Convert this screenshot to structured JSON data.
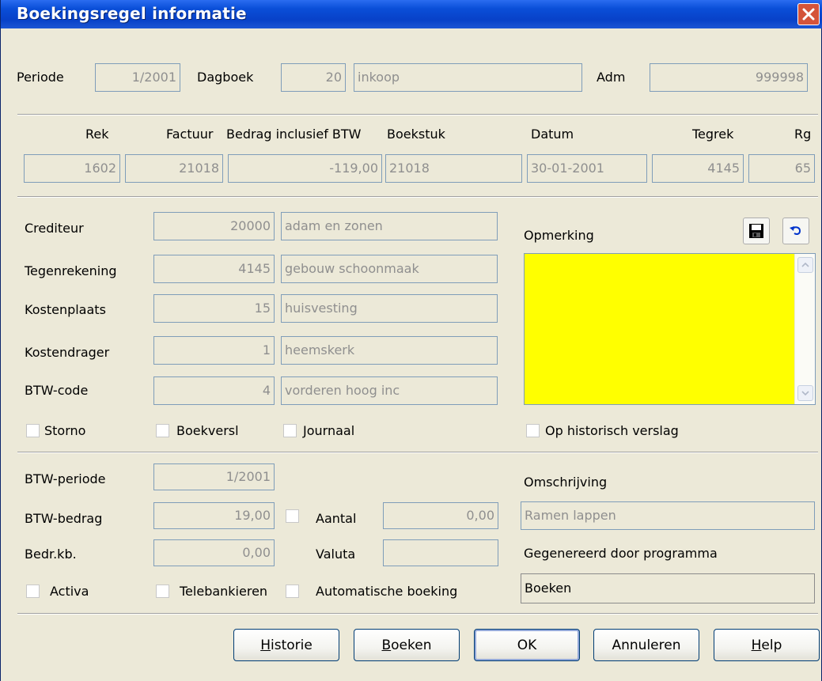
{
  "window": {
    "title": "Boekingsregel informatie"
  },
  "header": {
    "periode_label": "Periode",
    "periode_value": "1/2001",
    "dagboek_label": "Dagboek",
    "dagboek_value": "20",
    "dagboek_name": "inkoop",
    "adm_label": "Adm",
    "adm_value": "999998"
  },
  "line": {
    "columns": [
      "Rek",
      "Factuur",
      "Bedrag inclusief BTW",
      "Boekstuk",
      "Datum",
      "Tegrek",
      "Rg"
    ],
    "values": [
      "1602",
      "21018",
      "-119,00",
      "21018",
      "30-01-2001",
      "4145",
      "65"
    ]
  },
  "details": {
    "crediteur": {
      "label": "Crediteur",
      "code": "20000",
      "name": "adam en zonen"
    },
    "tegenrekening": {
      "label": "Tegenrekening",
      "code": "4145",
      "name": "gebouw schoonmaak"
    },
    "kostenplaats": {
      "label": "Kostenplaats",
      "code": "15",
      "name": "huisvesting"
    },
    "kostendrager": {
      "label": "Kostendrager",
      "code": "1",
      "name": "heemskerk"
    },
    "btwcode": {
      "label": "BTW-code",
      "code": "4",
      "name": "vorderen hoog  inc"
    },
    "checks": {
      "storno": "Storno",
      "boekversl": "Boekversl",
      "journaal": "Journaal",
      "historisch": "Op historisch verslag"
    },
    "opmerking_label": "Opmerking",
    "memo_color": "#ffff00"
  },
  "btw": {
    "periode_label": "BTW-periode",
    "periode_value": "1/2001",
    "bedrag_label": "BTW-bedrag",
    "bedrag_value": "19,00",
    "aantal_label": "Aantal",
    "aantal_value": "0,00",
    "bedrkb_label": "Bedr.kb.",
    "bedrkb_value": "0,00",
    "valuta_label": "Valuta",
    "valuta_value": "",
    "omschrijving_label": "Omschrijving",
    "omschrijving_value": "Ramen lappen",
    "gegenereerd_label": "Gegenereerd door programma",
    "gegenereerd_value": "Boeken",
    "checks": {
      "activa": "Activa",
      "telebankieren": "Telebankieren",
      "automatische": "Automatische boeking"
    }
  },
  "buttons": {
    "historie": {
      "u": "H",
      "rest": "istorie"
    },
    "boeken": {
      "u": "B",
      "rest": "oeken"
    },
    "ok": "OK",
    "annuleren": "Annuleren",
    "help": {
      "u": "H",
      "rest": "elp"
    }
  }
}
